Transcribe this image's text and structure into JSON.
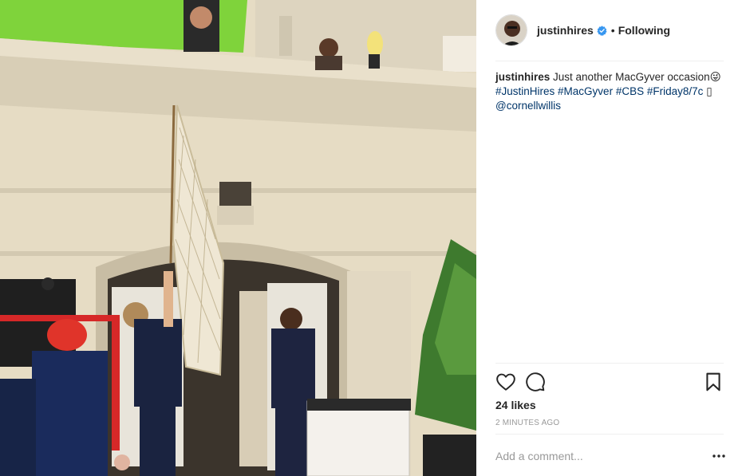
{
  "post": {
    "image_alt": "Behind-the-scenes photo of a film set with a cargo net being lowered from a balcony",
    "colors": {
      "link": "#003569",
      "text": "#262626",
      "muted": "#999999",
      "verified": "#3897f0"
    }
  },
  "header": {
    "username": "justinhires",
    "separator": "•",
    "follow_status": "Following"
  },
  "caption": {
    "username": "justinhires",
    "text": "Just another MacGyver occasion😜",
    "hashtags": [
      "#JustinHires",
      "#MacGyver",
      "#CBS",
      "#Friday8/7c"
    ],
    "trailing_glyph": "▯",
    "mention": "@cornellwillis"
  },
  "actions": {
    "like_icon": "heart-icon",
    "comment_icon": "comment-icon",
    "save_icon": "bookmark-icon"
  },
  "likes": "24 likes",
  "timestamp": "2 MINUTES AGO",
  "comment_box": {
    "placeholder": "Add a comment...",
    "more_icon": "ellipsis-icon"
  }
}
